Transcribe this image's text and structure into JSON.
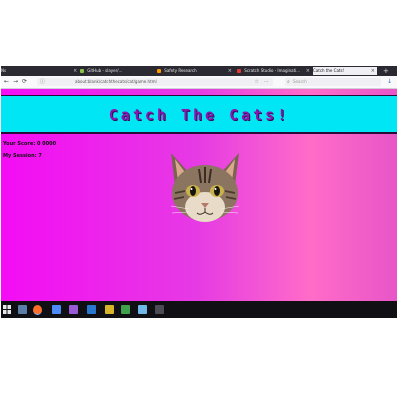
{
  "browser": {
    "tabs": [
      {
        "label": "Ns"
      },
      {
        "label": "GitHub - slayer/..."
      },
      {
        "label": "Safety Research"
      },
      {
        "label": "Scratch Studio - Imaginati..."
      },
      {
        "label": "Catch the Cats!"
      }
    ],
    "new_tab_label": "+",
    "url": "about:blank/catchthecats/cat/game.html",
    "search_placeholder": "Search"
  },
  "game": {
    "title": "Catch The Cats!",
    "score_text": "Your Score: 0 0000",
    "session_text": "My Session: 7"
  },
  "colors": {
    "banner": "#00e6f4",
    "page_gradient_start": "#f40cf4",
    "page_gradient_end": "#ff6cc8",
    "title": "#8818b0"
  }
}
